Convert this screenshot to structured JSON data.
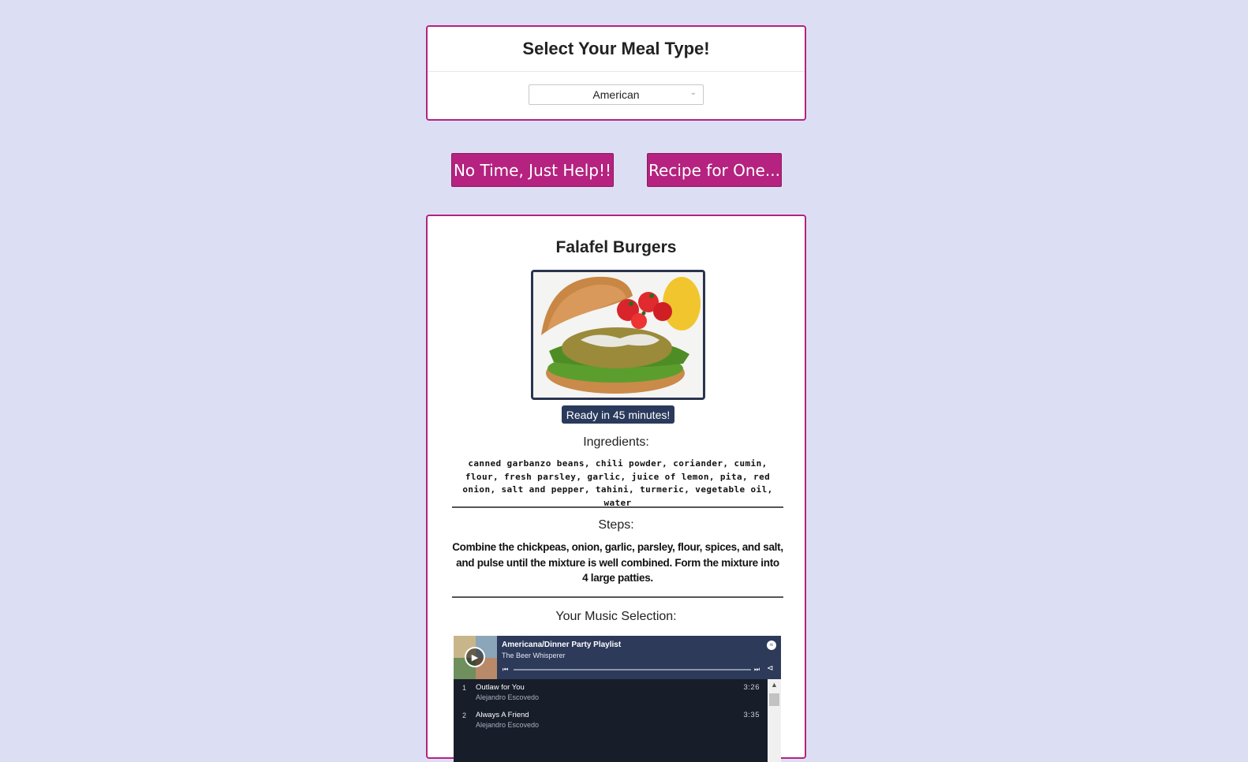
{
  "header": {
    "title": "Select Your Meal Type!"
  },
  "meal_select": {
    "selected": "American"
  },
  "buttons": {
    "help": "No Time, Just Help!!",
    "one": "Recipe for One..."
  },
  "recipe": {
    "title": "Falafel Burgers",
    "ready_badge": "Ready in 45 minutes!",
    "ingredients_label": "Ingredients:",
    "ingredients": "canned garbanzo beans, chili powder, coriander, cumin, flour, fresh parsley, garlic, juice of lemon, pita, red onion, salt and pepper, tahini, turmeric, vegetable oil, water",
    "steps_label": "Steps:",
    "steps": "Combine the chickpeas, onion, garlic, parsley, flour, spices, and salt, and pulse until the mixture is well combined. Form the mixture into 4 large patties.",
    "music_label": "Your Music Selection:"
  },
  "spotify": {
    "playlist": "Americana/Dinner Party Playlist",
    "owner": "The Beer Whisperer",
    "tracks": [
      {
        "num": "1",
        "title": "Outlaw for You",
        "artist": "Alejandro Escovedo",
        "duration": "3:26"
      },
      {
        "num": "2",
        "title": "Always A Friend",
        "artist": "Alejandro Escovedo",
        "duration": "3:35"
      }
    ]
  },
  "colors": {
    "accent": "#b5227f",
    "background": "#dcdff4",
    "badge": "#2a3a5c"
  }
}
